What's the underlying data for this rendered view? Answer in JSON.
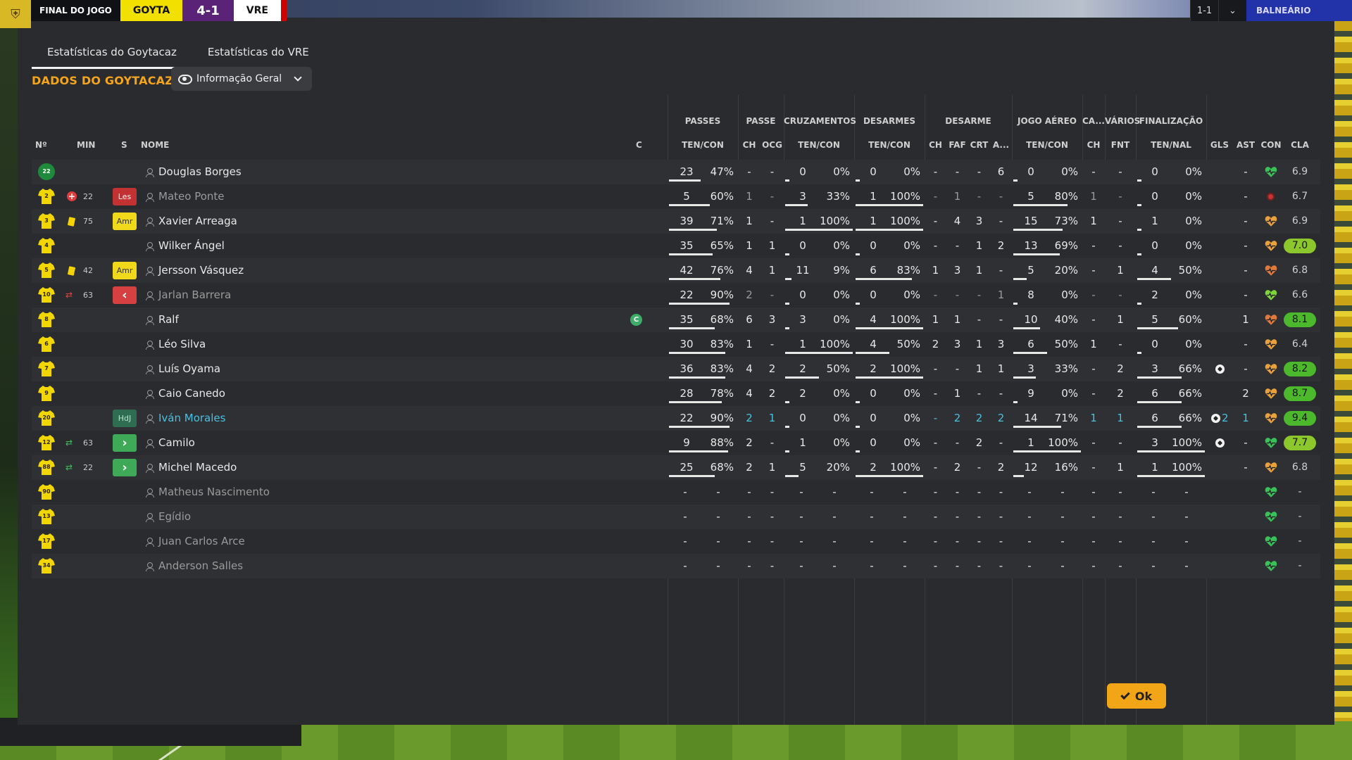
{
  "scoreboard": {
    "status": "FINAL DO JOGO",
    "home": "GOYTA",
    "score": "4-1",
    "away": "VRE",
    "right_score": "1-1",
    "right_label": "BALNEÁRIO"
  },
  "tabs": [
    {
      "label": "Estatísticas do Goytacaz",
      "active": true
    },
    {
      "label": "Estatísticas do VRE",
      "active": false
    }
  ],
  "section_title": "DADOS DO GOYTACAZ",
  "view_select": {
    "label": "Informação Geral",
    "icon": "eye-icon"
  },
  "groups": {
    "passes": "PASSES",
    "passe": "PASSE",
    "cruzamentos": "CRUZAMENTOS",
    "desarmes": "DESARMES",
    "desarme": "DESARME",
    "jogo_aereo": "JOGO AÉREO",
    "ca": "CA...",
    "varios": "VÁRIOS",
    "finalizacao": "FINALIZAÇÃO"
  },
  "headers": {
    "num": "Nº",
    "min": "MIN",
    "s": "S",
    "nome": "NOME",
    "c": "C",
    "passes": "TEN/CON",
    "ch": "CH",
    "ocg": "OCG",
    "cruz": "TEN/CON",
    "des": "TEN/CON",
    "dch": "CH",
    "faf": "FAF",
    "crt": "CRT",
    "a": "A...",
    "aereo": "TEN/CON",
    "cach": "CH",
    "fnt": "FNT",
    "fin": "TEN/NAL",
    "gls": "GLS",
    "ast": "AST",
    "con": "CON",
    "cla": "CLA"
  },
  "players": [
    {
      "num": "22",
      "gk": true,
      "min": "",
      "event": "",
      "badge": "",
      "name": "Douglas Borges",
      "dim": false,
      "link": false,
      "captain": false,
      "p_t": "23",
      "p_c": "47%",
      "p_f": 0.47,
      "ch": "-",
      "ocg": "-",
      "cr_t": "0",
      "cr_c": "0%",
      "cr_f": 0,
      "d_t": "0",
      "d_c": "0%",
      "d_f": 0,
      "dch": "-",
      "faf": "-",
      "crt": "-",
      "a": "6",
      "ae_t": "0",
      "ae_c": "0%",
      "ae_f": 0,
      "cach": "-",
      "fnt": "-",
      "f_t": "0",
      "f_c": "0%",
      "f_f": 0,
      "gls": "",
      "ast": "-",
      "con": "green",
      "cla": "6.9",
      "cla_style": "plain"
    },
    {
      "num": "2",
      "gk": false,
      "min": "22",
      "event": "injury",
      "badge": "Les",
      "badge_style": "les",
      "name": "Mateo Ponte",
      "dim": true,
      "link": false,
      "captain": false,
      "p_t": "5",
      "p_c": "60%",
      "p_f": 0.6,
      "ch": "1",
      "ocg": "-",
      "cr_t": "3",
      "cr_c": "33%",
      "cr_f": 0.33,
      "d_t": "1",
      "d_c": "100%",
      "d_f": 1,
      "dch": "-",
      "faf": "1",
      "crt": "-",
      "a": "-",
      "ae_t": "5",
      "ae_c": "80%",
      "ae_f": 0.8,
      "cach": "1",
      "fnt": "-",
      "f_t": "0",
      "f_c": "0%",
      "f_f": 0,
      "gls": "",
      "ast": "-",
      "con": "red",
      "cla": "6.7",
      "cla_style": "plain"
    },
    {
      "num": "3",
      "gk": false,
      "min": "75",
      "event": "yellow",
      "badge": "Amr",
      "badge_style": "amr",
      "name": "Xavier Arreaga",
      "dim": false,
      "link": false,
      "captain": false,
      "p_t": "39",
      "p_c": "71%",
      "p_f": 0.71,
      "ch": "1",
      "ocg": "-",
      "cr_t": "1",
      "cr_c": "100%",
      "cr_f": 1,
      "d_t": "1",
      "d_c": "100%",
      "d_f": 1,
      "dch": "-",
      "faf": "4",
      "crt": "3",
      "a": "-",
      "ae_t": "15",
      "ae_c": "73%",
      "ae_f": 0.73,
      "cach": "1",
      "fnt": "-",
      "f_t": "1",
      "f_c": "0%",
      "f_f": 0,
      "gls": "",
      "ast": "-",
      "con": "orange",
      "cla": "6.9",
      "cla_style": "plain"
    },
    {
      "num": "4",
      "gk": false,
      "min": "",
      "event": "",
      "badge": "",
      "name": "Wilker Ángel",
      "dim": false,
      "link": false,
      "captain": false,
      "p_t": "35",
      "p_c": "65%",
      "p_f": 0.65,
      "ch": "1",
      "ocg": "1",
      "cr_t": "0",
      "cr_c": "0%",
      "cr_f": 0,
      "d_t": "0",
      "d_c": "0%",
      "d_f": 0,
      "dch": "-",
      "faf": "-",
      "crt": "1",
      "a": "2",
      "ae_t": "13",
      "ae_c": "69%",
      "ae_f": 0.69,
      "cach": "-",
      "fnt": "-",
      "f_t": "0",
      "f_c": "0%",
      "f_f": 0,
      "gls": "",
      "ast": "-",
      "con": "orange",
      "cla": "7.0",
      "cla_style": "lgreen"
    },
    {
      "num": "5",
      "gk": false,
      "min": "42",
      "event": "yellow",
      "badge": "Amr",
      "badge_style": "amr",
      "name": "Jersson Vásquez",
      "dim": false,
      "link": false,
      "captain": false,
      "p_t": "42",
      "p_c": "76%",
      "p_f": 0.76,
      "ch": "4",
      "ocg": "1",
      "cr_t": "11",
      "cr_c": "9%",
      "cr_f": 0.09,
      "d_t": "6",
      "d_c": "83%",
      "d_f": 0.83,
      "dch": "1",
      "faf": "3",
      "crt": "1",
      "a": "-",
      "ae_t": "5",
      "ae_c": "20%",
      "ae_f": 0.2,
      "cach": "-",
      "fnt": "1",
      "f_t": "4",
      "f_c": "50%",
      "f_f": 0.5,
      "gls": "",
      "ast": "-",
      "con": "orangered",
      "cla": "6.8",
      "cla_style": "plain"
    },
    {
      "num": "10",
      "gk": false,
      "min": "63",
      "event": "subout",
      "badge": "‹",
      "badge_style": "subout",
      "name": "Jarlan Barrera",
      "dim": true,
      "link": false,
      "captain": false,
      "p_t": "22",
      "p_c": "90%",
      "p_f": 0.9,
      "ch": "2",
      "ocg": "-",
      "cr_t": "0",
      "cr_c": "0%",
      "cr_f": 0,
      "d_t": "0",
      "d_c": "0%",
      "d_f": 0,
      "dch": "-",
      "faf": "-",
      "crt": "-",
      "a": "1",
      "ae_t": "8",
      "ae_c": "0%",
      "ae_f": 0,
      "cach": "-",
      "fnt": "-",
      "f_t": "2",
      "f_c": "0%",
      "f_f": 0,
      "gls": "",
      "ast": "-",
      "con": "lime",
      "cla": "6.6",
      "cla_style": "plain"
    },
    {
      "num": "8",
      "gk": false,
      "min": "",
      "event": "",
      "badge": "",
      "name": "Ralf",
      "dim": false,
      "link": false,
      "captain": true,
      "p_t": "35",
      "p_c": "68%",
      "p_f": 0.68,
      "ch": "6",
      "ocg": "3",
      "cr_t": "3",
      "cr_c": "0%",
      "cr_f": 0,
      "d_t": "4",
      "d_c": "100%",
      "d_f": 1,
      "dch": "1",
      "faf": "1",
      "crt": "-",
      "a": "-",
      "ae_t": "10",
      "ae_c": "40%",
      "ae_f": 0.4,
      "cach": "-",
      "fnt": "1",
      "f_t": "5",
      "f_c": "60%",
      "f_f": 0.6,
      "gls": "",
      "ast": "1",
      "con": "orangered",
      "cla": "8.1",
      "cla_style": "green"
    },
    {
      "num": "6",
      "gk": false,
      "min": "",
      "event": "",
      "badge": "",
      "name": "Léo Silva",
      "dim": false,
      "link": false,
      "captain": false,
      "p_t": "30",
      "p_c": "83%",
      "p_f": 0.83,
      "ch": "1",
      "ocg": "-",
      "cr_t": "1",
      "cr_c": "100%",
      "cr_f": 1,
      "d_t": "4",
      "d_c": "50%",
      "d_f": 0.5,
      "dch": "2",
      "faf": "3",
      "crt": "1",
      "a": "3",
      "ae_t": "6",
      "ae_c": "50%",
      "ae_f": 0.5,
      "cach": "1",
      "fnt": "-",
      "f_t": "0",
      "f_c": "0%",
      "f_f": 0,
      "gls": "",
      "ast": "-",
      "con": "orange",
      "cla": "6.4",
      "cla_style": "plain"
    },
    {
      "num": "7",
      "gk": false,
      "min": "",
      "event": "",
      "badge": "",
      "name": "Luís Oyama",
      "dim": false,
      "link": false,
      "captain": false,
      "p_t": "36",
      "p_c": "83%",
      "p_f": 0.83,
      "ch": "4",
      "ocg": "2",
      "cr_t": "2",
      "cr_c": "50%",
      "cr_f": 0.5,
      "d_t": "2",
      "d_c": "100%",
      "d_f": 1,
      "dch": "-",
      "faf": "-",
      "crt": "1",
      "a": "1",
      "ae_t": "3",
      "ae_c": "33%",
      "ae_f": 0.33,
      "cach": "-",
      "fnt": "2",
      "f_t": "3",
      "f_c": "66%",
      "f_f": 0.66,
      "gls": "ball",
      "ast": "-",
      "con": "orange",
      "cla": "8.2",
      "cla_style": "green"
    },
    {
      "num": "9",
      "gk": false,
      "min": "",
      "event": "",
      "badge": "",
      "name": "Caio Canedo",
      "dim": false,
      "link": false,
      "captain": false,
      "p_t": "28",
      "p_c": "78%",
      "p_f": 0.78,
      "ch": "4",
      "ocg": "2",
      "cr_t": "2",
      "cr_c": "0%",
      "cr_f": 0,
      "d_t": "0",
      "d_c": "0%",
      "d_f": 0,
      "dch": "-",
      "faf": "1",
      "crt": "-",
      "a": "-",
      "ae_t": "9",
      "ae_c": "0%",
      "ae_f": 0,
      "cach": "-",
      "fnt": "2",
      "f_t": "6",
      "f_c": "66%",
      "f_f": 0.66,
      "gls": "",
      "ast": "2",
      "con": "orange",
      "cla": "8.7",
      "cla_style": "green"
    },
    {
      "num": "20",
      "gk": false,
      "min": "",
      "event": "",
      "badge": "HdJ",
      "badge_style": "hdj",
      "name": "Iván Morales",
      "dim": false,
      "link": true,
      "captain": false,
      "p_t": "22",
      "p_c": "90%",
      "p_f": 0.9,
      "ch": "2",
      "ocg": "1",
      "cr_t": "0",
      "cr_c": "0%",
      "cr_f": 0,
      "d_t": "0",
      "d_c": "0%",
      "d_f": 0,
      "dch": "-",
      "faf": "2",
      "crt": "2",
      "a": "2",
      "ae_t": "14",
      "ae_c": "71%",
      "ae_f": 0.71,
      "cach": "1",
      "fnt": "1",
      "f_t": "6",
      "f_c": "66%",
      "f_f": 0.66,
      "gls": "ball2",
      "gls_text": "2",
      "ast": "1",
      "con": "orange",
      "cla": "9.4",
      "cla_style": "green"
    },
    {
      "num": "12",
      "gk": false,
      "min": "63",
      "event": "subin",
      "badge": "›",
      "badge_style": "subin",
      "name": "Camilo",
      "dim": false,
      "link": false,
      "captain": false,
      "p_t": "9",
      "p_c": "88%",
      "p_f": 0.88,
      "ch": "2",
      "ocg": "-",
      "cr_t": "1",
      "cr_c": "0%",
      "cr_f": 0,
      "d_t": "0",
      "d_c": "0%",
      "d_f": 0,
      "dch": "-",
      "faf": "-",
      "crt": "2",
      "a": "-",
      "ae_t": "1",
      "ae_c": "100%",
      "ae_f": 1,
      "cach": "-",
      "fnt": "-",
      "f_t": "3",
      "f_c": "100%",
      "f_f": 1,
      "gls": "ball",
      "ast": "-",
      "con": "green",
      "cla": "7.7",
      "cla_style": "lgreen"
    },
    {
      "num": "88",
      "gk": false,
      "min": "22",
      "event": "subin",
      "badge": "›",
      "badge_style": "subin",
      "name": "Michel Macedo",
      "dim": false,
      "link": false,
      "captain": false,
      "p_t": "25",
      "p_c": "68%",
      "p_f": 0.68,
      "ch": "2",
      "ocg": "1",
      "cr_t": "5",
      "cr_c": "20%",
      "cr_f": 0.2,
      "d_t": "2",
      "d_c": "100%",
      "d_f": 1,
      "dch": "-",
      "faf": "2",
      "crt": "-",
      "a": "2",
      "ae_t": "12",
      "ae_c": "16%",
      "ae_f": 0.16,
      "cach": "-",
      "fnt": "1",
      "f_t": "1",
      "f_c": "100%",
      "f_f": 1,
      "gls": "",
      "ast": "-",
      "con": "orange",
      "cla": "6.8",
      "cla_style": "plain"
    },
    {
      "num": "90",
      "gk": false,
      "bench": true,
      "name": "Matheus Nascimento",
      "con": "green",
      "cla": "-"
    },
    {
      "num": "13",
      "gk": false,
      "bench": true,
      "name": "Egídio",
      "con": "green",
      "cla": "-"
    },
    {
      "num": "17",
      "gk": false,
      "bench": true,
      "name": "Juan Carlos Arce",
      "con": "green",
      "cla": "-"
    },
    {
      "num": "34",
      "gk": false,
      "bench": true,
      "name": "Anderson Salles",
      "con": "green",
      "cla": "-"
    }
  ],
  "captain_letter": "C",
  "ok_label": "Ok",
  "colors": {
    "accent": "#f4a51c",
    "link": "#48c1e0",
    "rating_green": "#4cb82b",
    "rating_lightgreen": "#8cc72b",
    "home_shirt": "#f2d600",
    "gk_shirt": "#1e8a3c"
  }
}
